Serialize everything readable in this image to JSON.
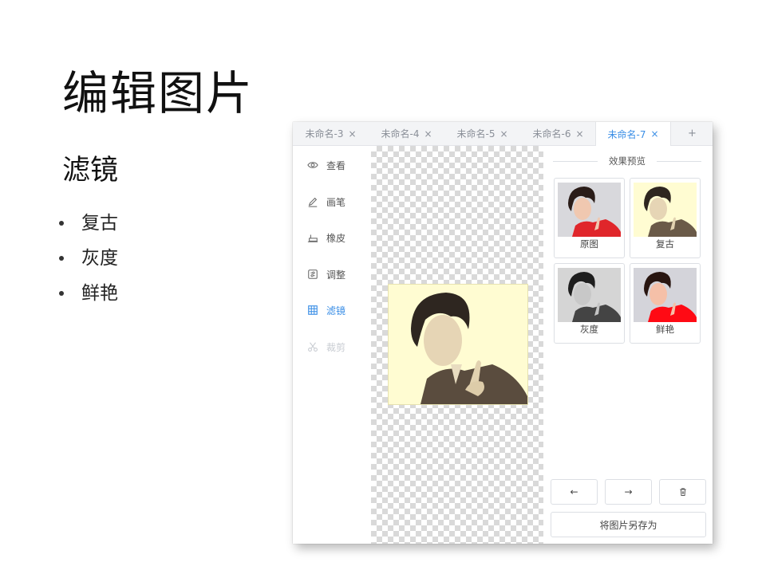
{
  "slide": {
    "title": "编辑图片",
    "subtitle": "滤镜",
    "bullets": [
      "复古",
      "灰度",
      "鲜艳"
    ]
  },
  "tabs": [
    {
      "label": "未命名-3",
      "active": false
    },
    {
      "label": "未命名-4",
      "active": false
    },
    {
      "label": "未命名-5",
      "active": false
    },
    {
      "label": "未命名-6",
      "active": false
    },
    {
      "label": "未命名-7",
      "active": true
    }
  ],
  "tab_close_glyph": "×",
  "tab_add_glyph": "+",
  "tools": [
    {
      "label": "查看",
      "icon": "eye-icon",
      "state": "normal"
    },
    {
      "label": "画笔",
      "icon": "pen-icon",
      "state": "normal"
    },
    {
      "label": "橡皮",
      "icon": "eraser-icon",
      "state": "normal"
    },
    {
      "label": "调整",
      "icon": "adjust-icon",
      "state": "normal"
    },
    {
      "label": "滤镜",
      "icon": "filter-icon",
      "state": "active"
    },
    {
      "label": "裁剪",
      "icon": "scissors-icon",
      "state": "disabled"
    }
  ],
  "preview": {
    "header": "效果预览",
    "filters": [
      {
        "label": "原图",
        "bg": "#d8d8dc",
        "shirt": "#e0262b",
        "tone": "original"
      },
      {
        "label": "复古",
        "bg": "#fffcd2",
        "shirt": "#6a5a48",
        "tone": "sepia"
      },
      {
        "label": "灰度",
        "bg": "#d5d5d5",
        "shirt": "#444444",
        "tone": "gray"
      },
      {
        "label": "鲜艳",
        "bg": "#d4d4da",
        "shirt": "#ff0a14",
        "tone": "vivid"
      }
    ]
  },
  "actions": {
    "undo_icon": "arrow-left-icon",
    "redo_icon": "arrow-right-icon",
    "delete_icon": "trash-icon",
    "undo_glyph": "←",
    "redo_glyph": "→",
    "save_label": "将图片另存为"
  },
  "colors": {
    "accent": "#3a8ee6",
    "disabled": "#c8ccd2",
    "sepia_bg": "#fffcd2"
  }
}
